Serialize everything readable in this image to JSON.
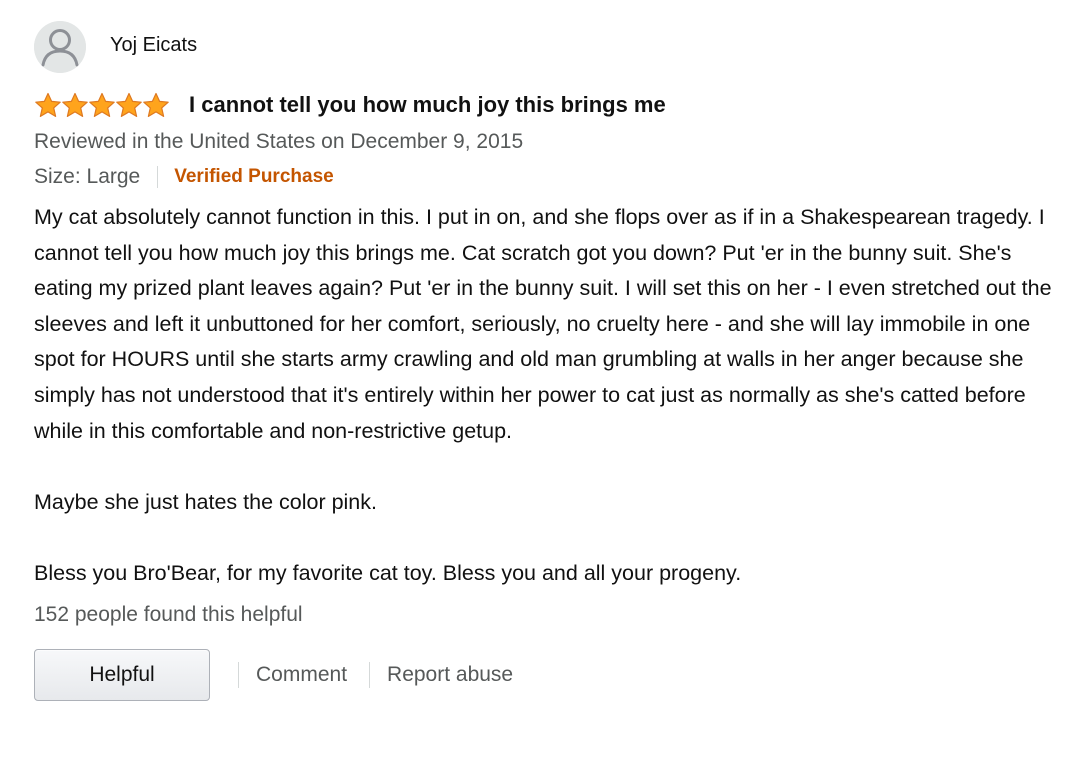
{
  "review": {
    "profile_name": "Yoj Eicats",
    "avatar_icon": "user-silhouette-icon",
    "rating": 5,
    "rating_max": 5,
    "star_color": "#ffa41c",
    "title": "I cannot tell you how much joy this brings me",
    "date_text": "Reviewed in the United States on December 9, 2015",
    "size_text": "Size: Large",
    "verified_text": "Verified Purchase",
    "verified_color": "#c45500",
    "body": [
      "My cat absolutely cannot function in this. I put in on, and she flops over as if in a Shakespearean tragedy. I cannot tell you how much joy this brings me. Cat scratch got you down? Put 'er in the bunny suit. She's eating my prized plant leaves again? Put 'er in the bunny suit. I will set this on her - I even stretched out the sleeves and left it unbuttoned for her comfort, seriously, no cruelty here - and she will lay immobile in one spot for HOURS until she starts army crawling and old man grumbling at walls in her anger because she simply has not understood that it's entirely within her power to cat just as normally as she's catted before while in this comfortable and non-restrictive getup.",
      "Maybe she just hates the color pink.",
      "Bless you Bro'Bear, for my favorite cat toy. Bless you and all your progeny."
    ],
    "helpful_count_text": "152 people found this helpful"
  },
  "actions": {
    "helpful_label": "Helpful",
    "comment_label": "Comment",
    "report_label": "Report abuse"
  }
}
